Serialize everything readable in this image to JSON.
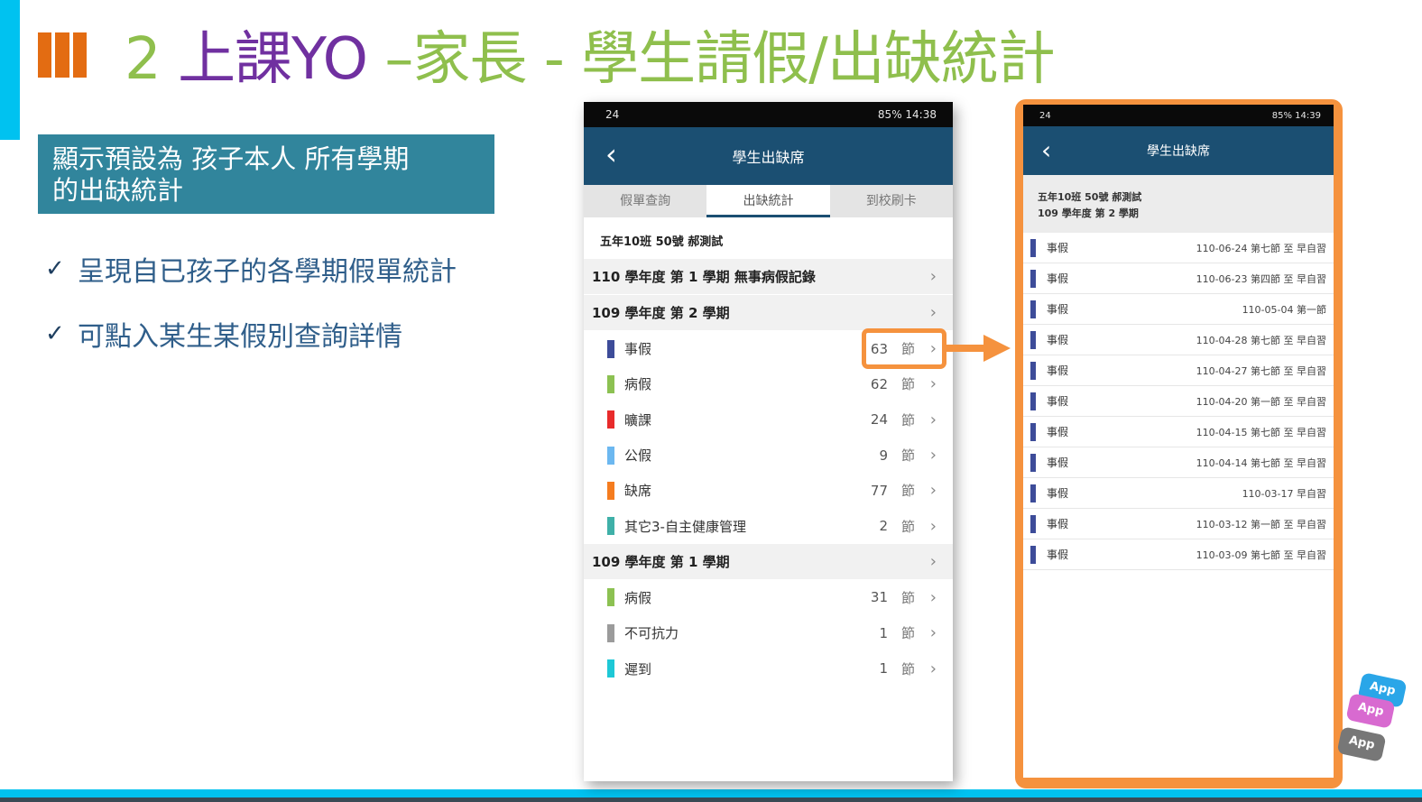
{
  "title": {
    "part1": "2 ",
    "part2": "上課YO",
    "part3": " –家長 - 學生請假/出缺統計"
  },
  "subtitle": {
    "line1": "顯示預設為 孩子本人 所有學期",
    "line2": "的出缺統計"
  },
  "bullets": [
    "呈現自已孩子的各學期假單統計",
    "可點入某生某假別查詢詳情"
  ],
  "phone1": {
    "status_left": "24",
    "status_right": "85%  14:38",
    "header_title": "學生出缺席",
    "tabs": [
      "假單查詢",
      "出缺統計",
      "到校刷卡"
    ],
    "student": "五年10班  50號  郝測試",
    "semesters": [
      {
        "label": "110 學年度  第 1 學期 無事病假記錄"
      },
      {
        "label": "109 學年度  第 2 學期"
      },
      {
        "label": "109 學年度  第 1 學期"
      }
    ],
    "sem2_items": [
      {
        "name": "事假",
        "count": "63",
        "unit": "節",
        "color": "#3d4c99"
      },
      {
        "name": "病假",
        "count": "62",
        "unit": "節",
        "color": "#8cc152"
      },
      {
        "name": "曠課",
        "count": "24",
        "unit": "節",
        "color": "#e82b2b"
      },
      {
        "name": "公假",
        "count": "9",
        "unit": "節",
        "color": "#6cb8f0"
      },
      {
        "name": "缺席",
        "count": "77",
        "unit": "節",
        "color": "#f57c1f"
      },
      {
        "name": "其它3-自主健康管理",
        "count": "2",
        "unit": "節",
        "color": "#3fb0a8"
      }
    ],
    "sem1_items": [
      {
        "name": "病假",
        "count": "31",
        "unit": "節",
        "color": "#8cc152"
      },
      {
        "name": "不可抗力",
        "count": "1",
        "unit": "節",
        "color": "#9b9b9b"
      },
      {
        "name": "遲到",
        "count": "1",
        "unit": "節",
        "color": "#1ec8d6"
      }
    ]
  },
  "phone2": {
    "status_left": "24",
    "status_right": "85%  14:39",
    "header_title": "學生出缺席",
    "student": "五年10班  50號  郝測試",
    "semester": "109 學年度    第 2 學期",
    "records": [
      {
        "name": "事假",
        "detail": "110-06-24   第七節 至 早自習"
      },
      {
        "name": "事假",
        "detail": "110-06-23   第四節 至 早自習"
      },
      {
        "name": "事假",
        "detail": "110-05-04   第一節"
      },
      {
        "name": "事假",
        "detail": "110-04-28   第七節 至 早自習"
      },
      {
        "name": "事假",
        "detail": "110-04-27   第七節 至 早自習"
      },
      {
        "name": "事假",
        "detail": "110-04-20   第一節 至 早自習"
      },
      {
        "name": "事假",
        "detail": "110-04-15   第七節 至 早自習"
      },
      {
        "name": "事假",
        "detail": "110-04-14   第七節 至 早自習"
      },
      {
        "name": "事假",
        "detail": "110-03-17   早自習"
      },
      {
        "name": "事假",
        "detail": "110-03-12   第一節 至 早自習"
      },
      {
        "name": "事假",
        "detail": "110-03-09   第七節 至 早自習"
      }
    ]
  },
  "decor": {
    "badges": [
      "App",
      "App",
      "App"
    ]
  },
  "colors": {
    "accent_orange": "#f5923e",
    "header_blue": "#1b4f72",
    "cyan": "#00c2f0"
  }
}
